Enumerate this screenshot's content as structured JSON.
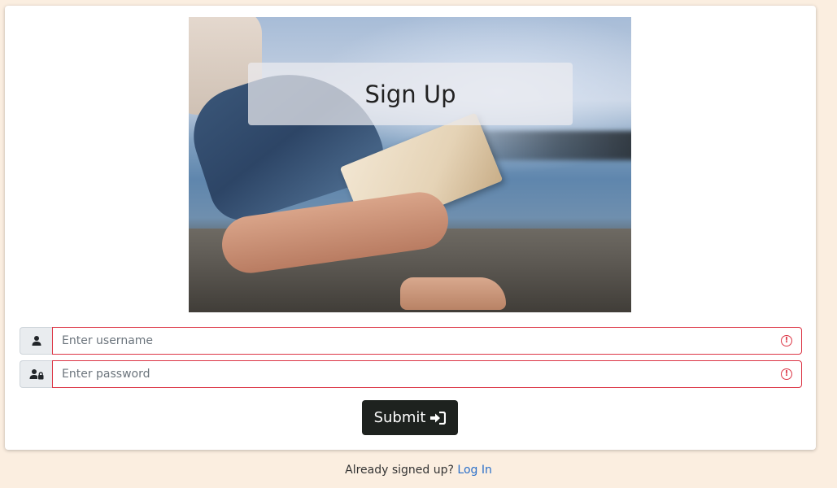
{
  "hero": {
    "title": "Sign Up"
  },
  "form": {
    "username": {
      "placeholder": "Enter username",
      "value": ""
    },
    "password": {
      "placeholder": "Enter password",
      "value": ""
    },
    "submit_label": "Submit"
  },
  "footer": {
    "text": "Already signed up?",
    "link_label": "Log In"
  },
  "colors": {
    "background": "#fbeee0",
    "error": "#dc3545",
    "button": "#1e221f",
    "link": "#2a6fc9"
  },
  "icons": {
    "username": "user-icon",
    "password": "user-lock-icon",
    "submit": "sign-in-icon",
    "validation": "exclamation-circle-icon"
  }
}
